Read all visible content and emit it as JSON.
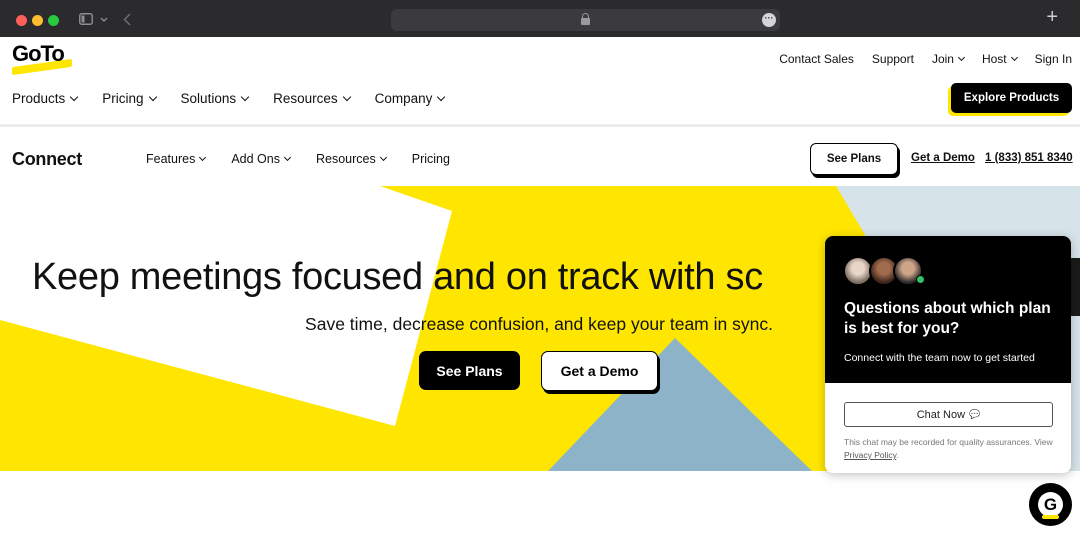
{
  "browser": {
    "icons": [
      "sidebar-icon",
      "chevron-down-icon",
      "back-icon",
      "lock-icon",
      "more-icon",
      "plus-icon"
    ],
    "new_tab_glyph": "+"
  },
  "global_header": {
    "logo_text": "GoTo",
    "utility_nav": [
      {
        "label": "Contact Sales",
        "has_menu": false
      },
      {
        "label": "Support",
        "has_menu": false
      },
      {
        "label": "Join",
        "has_menu": true
      },
      {
        "label": "Host",
        "has_menu": true
      },
      {
        "label": "Sign In",
        "has_menu": false
      }
    ],
    "main_nav": [
      "Products",
      "Pricing",
      "Solutions",
      "Resources",
      "Company"
    ],
    "cta": "Explore Products"
  },
  "product_header": {
    "name": "Connect",
    "nav": [
      {
        "label": "Features",
        "has_menu": true
      },
      {
        "label": "Add Ons",
        "has_menu": true
      },
      {
        "label": "Resources",
        "has_menu": true
      },
      {
        "label": "Pricing",
        "has_menu": false
      }
    ],
    "see_plans": "See Plans",
    "get_demo": "Get a Demo",
    "phone": "1 (833) 851 8340"
  },
  "hero": {
    "title": "Keep meetings focused and on track with sc",
    "subtitle": "Save time, decrease confusion, and keep your team in sync.",
    "primary_cta": "See Plans",
    "secondary_cta": "Get a Demo"
  },
  "chat": {
    "title": "Questions about which plan is best for you?",
    "description": "Connect with the team now to get started",
    "button": "Chat Now",
    "note_prefix": "This chat may be recorded for quality assurances. View ",
    "note_link": "Privacy Policy",
    "note_suffix": "."
  },
  "fab": {
    "label": "G"
  },
  "colors": {
    "brand_yellow": "#ffe600",
    "hero_blue": "#8db3c9",
    "hero_light_blue": "#d6e4ea",
    "black": "#000000"
  }
}
